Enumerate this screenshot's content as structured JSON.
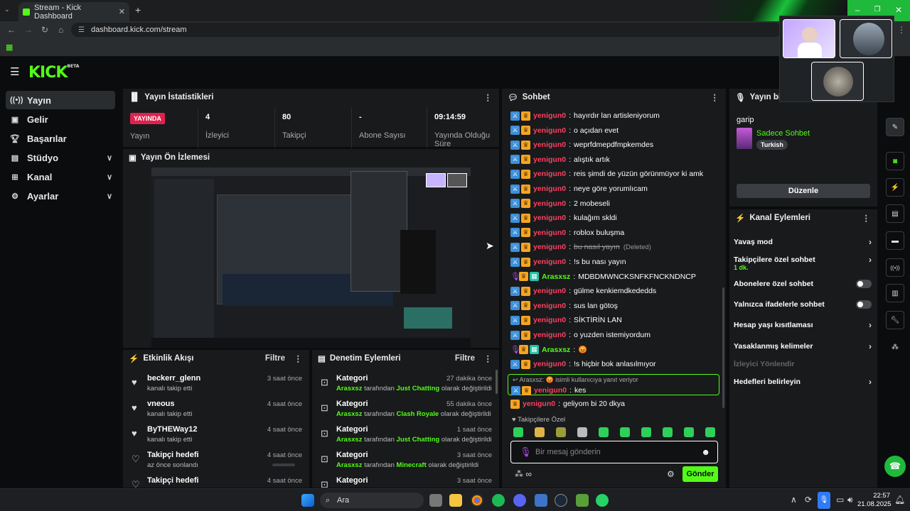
{
  "browser": {
    "tab_title": "Stream - Kick Dashboard",
    "url": "dashboard.kick.com/stream"
  },
  "brand": {
    "logo": "KICK",
    "beta": "BETA",
    "accent": "#53fc18",
    "live_color": "#e0214f"
  },
  "sidebar": {
    "items": [
      {
        "label": "Yayın",
        "active": true
      },
      {
        "label": "Gelir"
      },
      {
        "label": "Başarılar"
      },
      {
        "label": "Stüdyo"
      },
      {
        "label": "Kanal"
      },
      {
        "label": "Ayarlar"
      }
    ]
  },
  "stats": {
    "title": "Yayın İstatistikleri",
    "status_badge": "YAYINDA",
    "status_label": "Yayın",
    "cells": [
      {
        "value": "4",
        "label": "İzleyici"
      },
      {
        "value": "80",
        "label": "Takipçi"
      },
      {
        "value": "-",
        "label": "Abone Sayısı"
      },
      {
        "value": "09:14:59",
        "label": "Yayında Olduğu Süre"
      }
    ]
  },
  "preview": {
    "title": "Yayın Ön İzlemesi"
  },
  "activity": {
    "title": "Etkinlik Akışı",
    "filter": "Filtre",
    "items": [
      {
        "title": "beckerr_glenn",
        "sub": "kanalı takip etti",
        "time": "3 saat önce",
        "icon": "heart-icon"
      },
      {
        "title": "vneous",
        "sub": "kanalı takip etti",
        "time": "4 saat önce",
        "icon": "heart-icon"
      },
      {
        "title": "ByTHEWay12",
        "sub": "kanalı takip etti",
        "time": "4 saat önce",
        "icon": "heart-icon"
      },
      {
        "title": "Takipçi hedefi",
        "sub": "az önce sonlandı",
        "time": "4 saat önce",
        "icon": "heart-outline-icon"
      },
      {
        "title": "Takipçi hedefi",
        "sub": "",
        "time": "4 saat önce",
        "icon": "heart-outline-icon"
      }
    ]
  },
  "moderation": {
    "title": "Denetim Eylemleri",
    "filter": "Filtre",
    "items": [
      {
        "title": "Kategori",
        "time": "27 dakika önce",
        "actor": "Arasxsz",
        "mid": "tarafından",
        "category": "Just Chatting",
        "tail": "olarak değiştirildi"
      },
      {
        "title": "Kategori",
        "time": "55 dakika önce",
        "actor": "Arasxsz",
        "mid": "tarafından",
        "category": "Clash Royale",
        "tail": "olarak değiştirildi"
      },
      {
        "title": "Kategori",
        "time": "1 saat önce",
        "actor": "Arasxsz",
        "mid": "tarafından",
        "category": "Just Chatting",
        "tail": "olarak değiştirildi"
      },
      {
        "title": "Kategori",
        "time": "3 saat önce",
        "actor": "Arasxsz",
        "mid": "tarafından",
        "category": "Minecraft",
        "tail": "olarak değiştirildi"
      },
      {
        "title": "Kategori",
        "time": "3 saat önce",
        "actor": "",
        "mid": "",
        "category": "",
        "tail": ""
      }
    ]
  },
  "chat": {
    "title": "Sohbet",
    "messages": [
      {
        "user": "yenigun0",
        "text": "hayırdır lan artisleniyorum"
      },
      {
        "user": "yenigun0",
        "text": "o açıdan evet"
      },
      {
        "user": "yenigun0",
        "text": "weprfdmepdfmpkemdes"
      },
      {
        "user": "yenigun0",
        "text": "alıştık artık"
      },
      {
        "user": "yenigun0",
        "text": "reis şimdi de yüzün görünmüyor ki amk"
      },
      {
        "user": "yenigun0",
        "text": "neye göre yorumlıcam"
      },
      {
        "user": "yenigun0",
        "text": "2 mobeseli"
      },
      {
        "user": "yenigun0",
        "text": "kulağım skldi"
      },
      {
        "user": "yenigun0",
        "text": "roblox buluşma"
      },
      {
        "user": "yenigun0",
        "text": "bu nasıl yayın",
        "deleted": true,
        "note": "(Deleted)"
      },
      {
        "user": "yenigun0",
        "text": "!s bu nası yayın"
      },
      {
        "user": "Arasxsz",
        "text": "MDBDMWNCKSNFKFNCKNDNCP",
        "owner": true
      },
      {
        "user": "yenigun0",
        "text": "gülme kenkiemdkededds"
      },
      {
        "user": "yenigun0",
        "text": "sus lan götoş"
      },
      {
        "user": "yenigun0",
        "text": "SİKTİRİN LAN"
      },
      {
        "user": "yenigun0",
        "text": "o yuzden istemiyordum"
      },
      {
        "user": "Arasxsz",
        "text": "😡",
        "owner": true
      },
      {
        "user": "yenigun0",
        "text": "!s hiçbir bok anlasılmıyor"
      }
    ],
    "reply": {
      "header": "Arasxsz: 😡 isimli kullanıcıya yanıt veriyor",
      "user": "yenigun0",
      "text": "kes"
    },
    "last": {
      "user": "yenigun0",
      "text": "geliyom bi 20 dkya"
    },
    "followers_only": "Takipçilere Özel",
    "input_placeholder": "Bir mesaj gönderin",
    "send": "Gönder"
  },
  "stream_info": {
    "title": "Yayın bilgisi",
    "stream_title": "garip",
    "category": "Sadece Sohbet",
    "tag": "Turkish",
    "edit": "Düzenle"
  },
  "channel_actions": {
    "title": "Kanal Eylemleri",
    "items": [
      {
        "label": "Yavaş mod",
        "type": "chevron"
      },
      {
        "label": "Takipçilere özel sohbet",
        "sub": "1 dk.",
        "type": "chevron"
      },
      {
        "label": "Abonelere özel sohbet",
        "type": "toggle"
      },
      {
        "label": "Yalnızca ifadelerle sohbet",
        "type": "toggle"
      },
      {
        "label": "Hesap yaşı kısıtlaması",
        "type": "chevron"
      },
      {
        "label": "Yasaklanmış kelimeler",
        "type": "chevron"
      },
      {
        "label": "İzleyici Yönlendir",
        "type": "disabled"
      },
      {
        "label": "Hedefleri belirleyin",
        "type": "chevron"
      }
    ]
  },
  "taskbar": {
    "search": "Ara",
    "time": "22:57",
    "date": "21.08.2025"
  }
}
